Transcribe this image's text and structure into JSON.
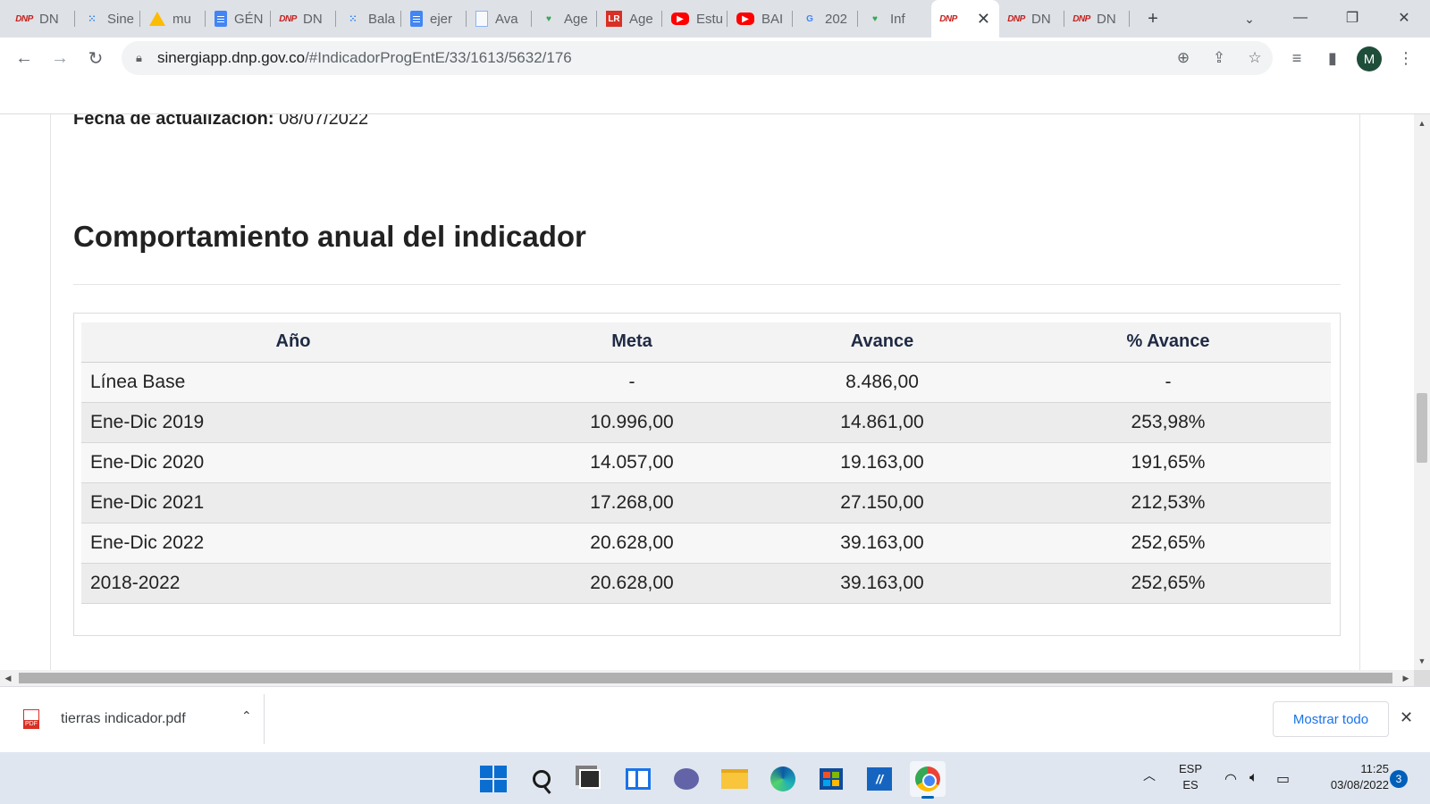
{
  "browser": {
    "tabs": [
      {
        "title": "DN",
        "icon": "dnp-icon"
      },
      {
        "title": "Sine",
        "icon": "dots-icon"
      },
      {
        "title": "mu",
        "icon": "drive-icon"
      },
      {
        "title": "GÉN",
        "icon": "docs-icon"
      },
      {
        "title": "DN",
        "icon": "dnp-icon"
      },
      {
        "title": "Bala",
        "icon": "dots-icon"
      },
      {
        "title": "ejer",
        "icon": "docs-icon"
      },
      {
        "title": "Ava",
        "icon": "pdf-icon"
      },
      {
        "title": "Age",
        "icon": "leaf-icon"
      },
      {
        "title": "Age",
        "icon": "lr-icon"
      },
      {
        "title": "Estu",
        "icon": "youtube-icon"
      },
      {
        "title": "BAI",
        "icon": "youtube-icon"
      },
      {
        "title": "202",
        "icon": "google-icon"
      },
      {
        "title": "Inf",
        "icon": "leaf-icon"
      },
      {
        "title": "",
        "icon": "dnp-icon",
        "active": true
      },
      {
        "title": "DN",
        "icon": "dnp-icon"
      },
      {
        "title": "DN",
        "icon": "dnp-icon"
      }
    ],
    "favicon_dnp_text": "DNP",
    "favicon_lr_text": "LR",
    "favicon_google_text": "G",
    "url": {
      "host": "sinergiapp.dnp.gov.co",
      "path": "/#IndicadorProgEntE/33/1613/5632/176"
    },
    "profile_initial": "M"
  },
  "page": {
    "fecha_label": "Fecha de actualización:",
    "fecha_value": "08/07/2022",
    "section_title": "Comportamiento anual del indicador",
    "table": {
      "headers": [
        "Año",
        "Meta",
        "Avance",
        "% Avance"
      ],
      "rows": [
        [
          "Línea Base",
          "-",
          "8.486,00",
          "-"
        ],
        [
          "Ene-Dic 2019",
          "10.996,00",
          "14.861,00",
          "253,98%"
        ],
        [
          "Ene-Dic 2020",
          "14.057,00",
          "19.163,00",
          "191,65%"
        ],
        [
          "Ene-Dic 2021",
          "17.268,00",
          "27.150,00",
          "212,53%"
        ],
        [
          "Ene-Dic 2022",
          "20.628,00",
          "39.163,00",
          "252,65%"
        ],
        [
          "2018-2022",
          "20.628,00",
          "39.163,00",
          "252,65%"
        ]
      ]
    }
  },
  "downloads": {
    "file_name": "tierras indicador.pdf",
    "file_badge": "PDF",
    "show_all_label": "Mostrar todo"
  },
  "taskbar": {
    "lang_top": "ESP",
    "lang_bottom": "ES",
    "time": "11:25",
    "date": "03/08/2022",
    "notification_count": "3"
  },
  "colors": {
    "accent": "#1a73e8",
    "tab_strip": "#dee1e6",
    "row_light": "#f7f7f7",
    "row_dark": "#ececec",
    "header_text": "#1f2a44"
  }
}
